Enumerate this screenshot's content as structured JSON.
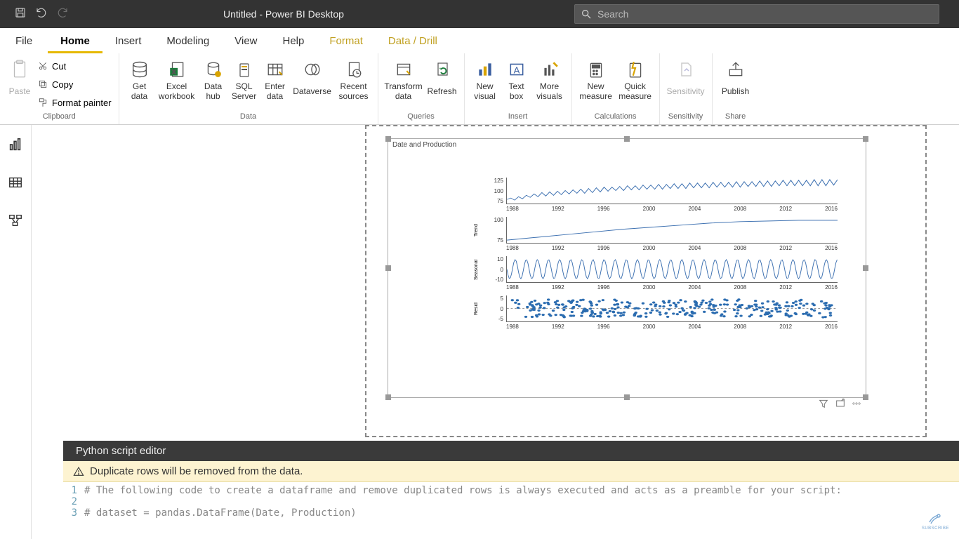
{
  "window": {
    "title": "Untitled - Power BI Desktop"
  },
  "search": {
    "placeholder": "Search"
  },
  "menu": {
    "items": [
      "File",
      "Home",
      "Insert",
      "Modeling",
      "View",
      "Help",
      "Format",
      "Data / Drill"
    ],
    "active": "Home",
    "context": [
      "Format",
      "Data / Drill"
    ]
  },
  "ribbon": {
    "groups": {
      "clipboard": {
        "label": "Clipboard",
        "paste": "Paste",
        "cut": "Cut",
        "copy": "Copy",
        "format_painter": "Format painter"
      },
      "data": {
        "label": "Data",
        "get_data": "Get\ndata",
        "excel": "Excel\nworkbook",
        "data_hub": "Data\nhub",
        "sql": "SQL\nServer",
        "enter": "Enter\ndata",
        "dataverse": "Dataverse",
        "recent": "Recent\nsources"
      },
      "queries": {
        "label": "Queries",
        "transform": "Transform\ndata",
        "refresh": "Refresh"
      },
      "insert": {
        "label": "Insert",
        "new_visual": "New\nvisual",
        "text_box": "Text\nbox",
        "more_visuals": "More\nvisuals"
      },
      "calculations": {
        "label": "Calculations",
        "new_measure": "New\nmeasure",
        "quick_measure": "Quick\nmeasure"
      },
      "sensitivity": {
        "label": "Sensitivity",
        "btn": "Sensitivity"
      },
      "share": {
        "label": "Share",
        "publish": "Publish"
      }
    }
  },
  "visual": {
    "title": "Date and Production"
  },
  "chart_data": [
    {
      "type": "line",
      "ylabel": "",
      "yticks": [
        75,
        100,
        125
      ],
      "xticks": [
        1988,
        1992,
        1996,
        2000,
        2004,
        2008,
        2012,
        2016
      ],
      "description": "Observed monthly production series with upward drift and strong yearly seasonality",
      "approx_range": {
        "x": [
          1985,
          2018
        ],
        "y": [
          65,
          130
        ]
      }
    },
    {
      "type": "line",
      "ylabel": "Trend",
      "yticks": [
        75,
        100
      ],
      "xticks": [
        1988,
        1992,
        1996,
        2000,
        2004,
        2008,
        2012,
        2016
      ],
      "description": "Smooth monotonically-increasing trend decomposed from the series",
      "approx_range": {
        "x": [
          1985,
          2018
        ],
        "y": [
          68,
          108
        ]
      }
    },
    {
      "type": "line",
      "ylabel": "Seasonal",
      "yticks": [
        -10,
        0,
        10
      ],
      "xticks": [
        1988,
        1992,
        1996,
        2000,
        2004,
        2008,
        2012,
        2016
      ],
      "description": "Periodic seasonal component, roughly ±10 amplitude, repeating yearly",
      "approx_range": {
        "x": [
          1985,
          2018
        ],
        "y": [
          -12,
          12
        ]
      }
    },
    {
      "type": "scatter",
      "ylabel": "Resid",
      "yticks": [
        -5,
        0,
        5
      ],
      "xticks": [
        1988,
        1992,
        1996,
        2000,
        2004,
        2008,
        2012,
        2016
      ],
      "description": "Residuals scatter, dense cloud centered on 0, roughly ±7 spread",
      "approx_range": {
        "x": [
          1985,
          2018
        ],
        "y": [
          -8,
          8
        ]
      }
    }
  ],
  "script_editor": {
    "title": "Python script editor",
    "warning": "Duplicate rows will be removed from the data.",
    "lines": [
      {
        "n": 1,
        "code": "# The following code to create a dataframe and remove duplicated rows is always executed and acts as a preamble for your script:"
      },
      {
        "n": 2,
        "code": ""
      },
      {
        "n": 3,
        "code": "# dataset = pandas.DataFrame(Date, Production)"
      }
    ]
  },
  "subscribe_label": "SUBSCRIBE"
}
